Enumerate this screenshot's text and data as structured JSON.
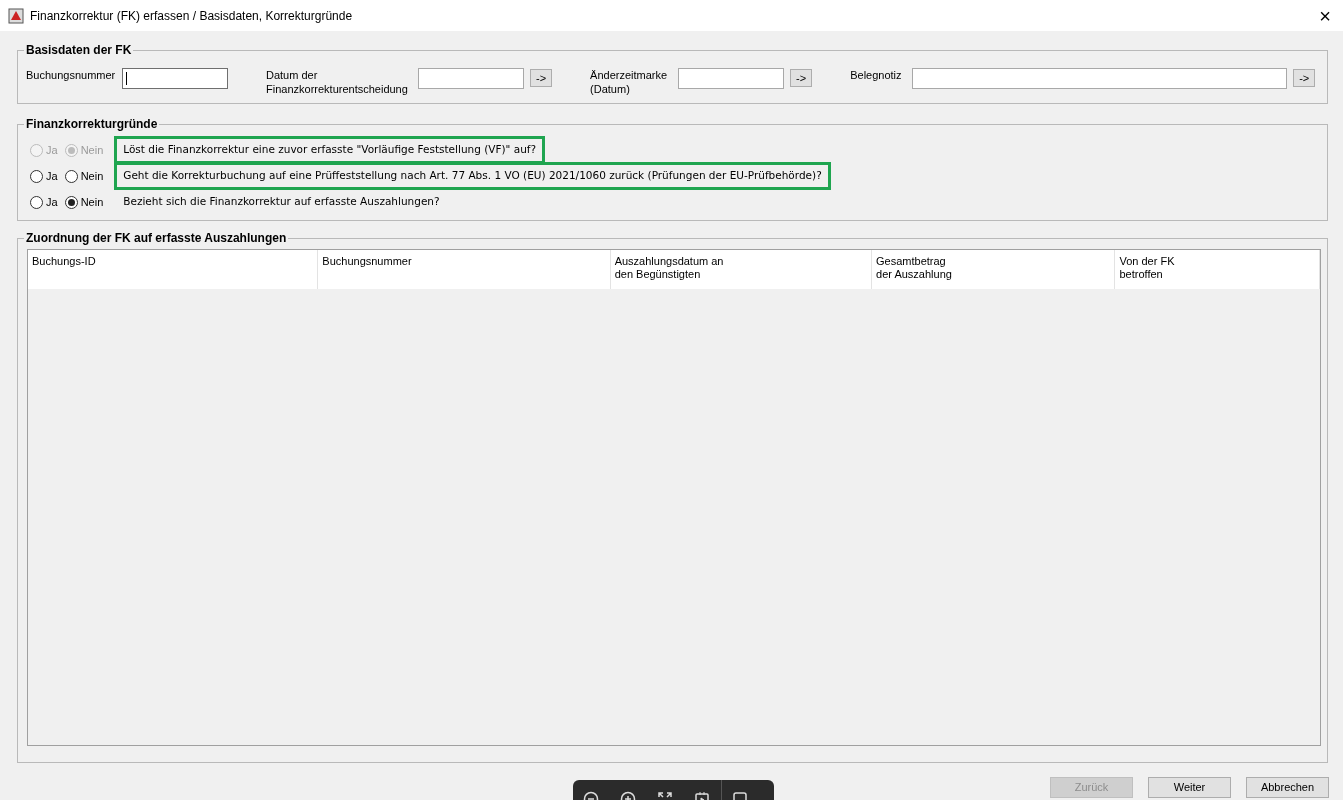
{
  "window": {
    "title": "Finanzkorrektur (FK) erfassen / Basisdaten, Korrekturgründe",
    "close": "×"
  },
  "basisdaten": {
    "title": "Basisdaten der FK",
    "fields": [
      {
        "label": "Buchungsnummer",
        "focused": true
      },
      {
        "label": "Datum der Finanzkorrekturentscheidung",
        "focused": false,
        "button": "->"
      },
      {
        "label": "Änderzeitmarke (Datum)",
        "focused": false,
        "button": "->"
      },
      {
        "label": "Belegnotiz",
        "focused": false,
        "button": "->"
      }
    ]
  },
  "gruende": {
    "title": "Finanzkorrekturgründe",
    "questions": [
      {
        "text": "Löst die Finanzkorrektur eine zuvor erfasste \"Vorläufige Feststellung (VF)\" auf?",
        "disabled": true,
        "highlighted": true,
        "options": [
          {
            "label": "Ja",
            "selected": false
          },
          {
            "label": "Nein",
            "selected": true
          }
        ]
      },
      {
        "text": "Geht die Korrekturbuchung auf eine Prüffeststellung nach Art. 77 Abs. 1 VO (EU) 2021/1060 zurück (Prüfungen der EU-Prüfbehörde)?",
        "disabled": false,
        "highlighted": true,
        "options": [
          {
            "label": "Ja",
            "selected": false
          },
          {
            "label": "Nein",
            "selected": false
          }
        ]
      },
      {
        "text": "Bezieht sich die Finanzkorrektur auf erfasste Auszahlungen?",
        "disabled": false,
        "highlighted": false,
        "options": [
          {
            "label": "Ja",
            "selected": false
          },
          {
            "label": "Nein",
            "selected": true
          }
        ]
      }
    ]
  },
  "zuordnung": {
    "title": "Zuordnung der FK auf erfasste Auszahlungen",
    "table": {
      "columns": [
        "Buchungs-ID",
        "Buchungsnummer",
        "Auszahlungsdatum an\nden Begünstigten",
        "Gesamtbetrag\nder Auszahlung",
        "Von der FK\nbetroffen"
      ]
    }
  },
  "buttons": [
    {
      "label": "Zurück",
      "disabled": true
    },
    {
      "label": "Weiter",
      "disabled": false
    },
    {
      "label": "Abbrechen",
      "disabled": false
    }
  ]
}
